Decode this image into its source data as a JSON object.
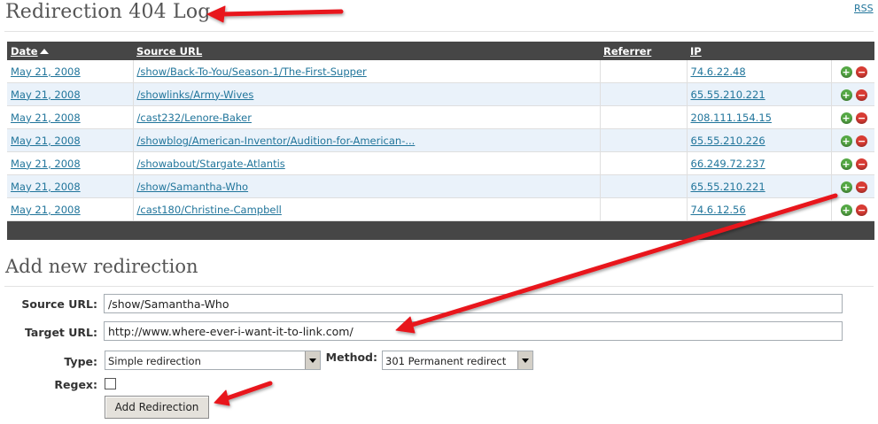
{
  "page": {
    "title": "Redirection 404 Log",
    "rss_link": "RSS"
  },
  "log_table": {
    "headers": {
      "date": "Date",
      "source": "Source URL",
      "referrer": "Referrer",
      "ip": "IP"
    },
    "rows": [
      {
        "date": "May 21, 2008",
        "source": "/show/Back-To-You/Season-1/The-First-Supper",
        "referrer": "",
        "ip": "74.6.22.48"
      },
      {
        "date": "May 21, 2008",
        "source": "/showlinks/Army-Wives",
        "referrer": "",
        "ip": "65.55.210.221"
      },
      {
        "date": "May 21, 2008",
        "source": "/cast232/Lenore-Baker",
        "referrer": "",
        "ip": "208.111.154.15"
      },
      {
        "date": "May 21, 2008",
        "source": "/showblog/American-Inventor/Audition-for-American-...",
        "referrer": "",
        "ip": "65.55.210.226"
      },
      {
        "date": "May 21, 2008",
        "source": "/showabout/Stargate-Atlantis",
        "referrer": "",
        "ip": "66.249.72.237"
      },
      {
        "date": "May 21, 2008",
        "source": "/show/Samantha-Who",
        "referrer": "",
        "ip": "65.55.210.221"
      },
      {
        "date": "May 21, 2008",
        "source": "/cast180/Christine-Campbell",
        "referrer": "",
        "ip": "74.6.12.56"
      }
    ],
    "add_icon": "+",
    "delete_icon": "−"
  },
  "add_form": {
    "heading": "Add new redirection",
    "source_label": "Source URL:",
    "source_value": "/show/Samantha-Who",
    "target_label": "Target URL:",
    "target_value": "http://www.where-ever-i-want-it-to-link.com/",
    "type_label": "Type:",
    "type_value": "Simple redirection",
    "method_label": "Method:",
    "method_value": "301 Permanent redirect",
    "regex_label": "Regex:",
    "submit_label": "Add Redirection"
  },
  "colors": {
    "header_bg": "#464646",
    "link": "#21759b",
    "row_alt": "#eaf2fa",
    "annotation_arrow": "#e8141c"
  }
}
